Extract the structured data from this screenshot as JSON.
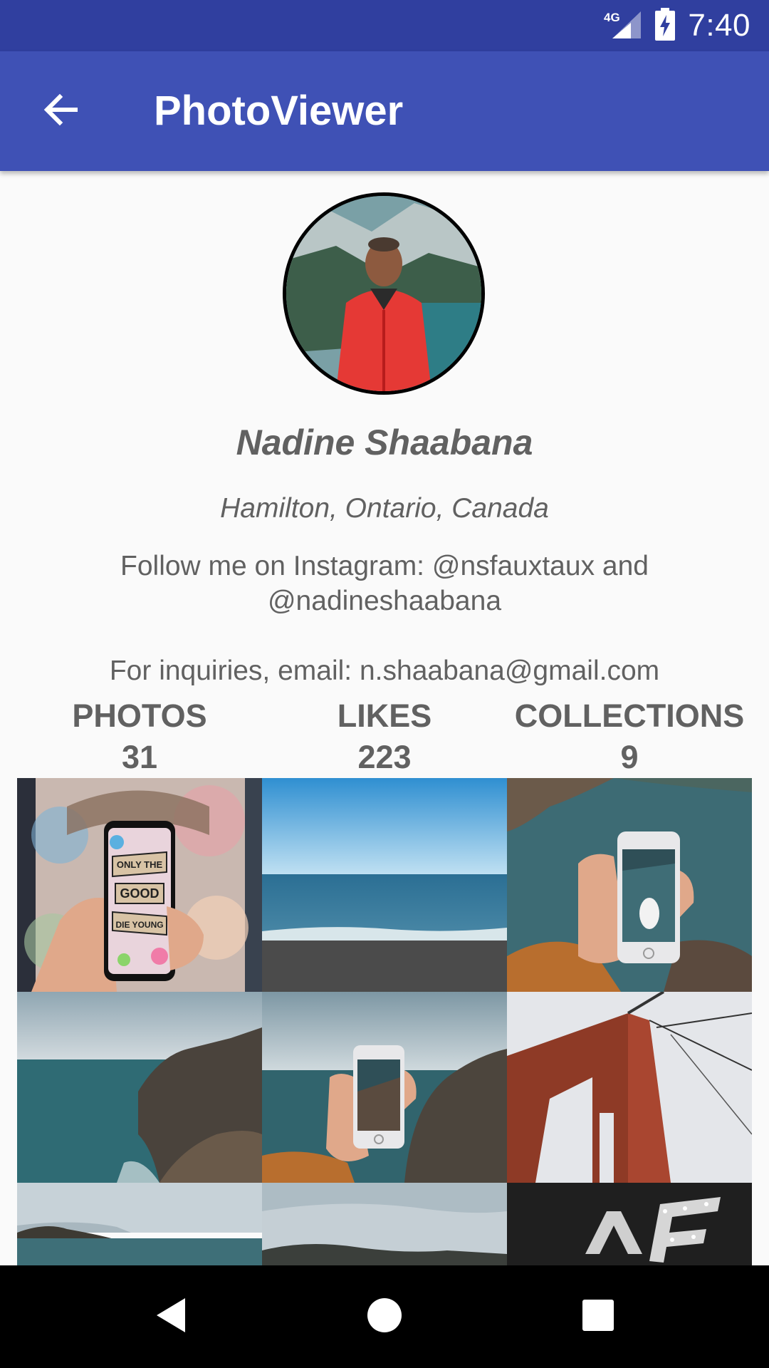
{
  "status_bar": {
    "network": "4G",
    "time": "7:40"
  },
  "app_bar": {
    "title": "PhotoViewer",
    "back_icon": "arrow-back-icon"
  },
  "profile": {
    "name": "Nadine Shaabana",
    "location": "Hamilton, Ontario, Canada",
    "bio": "Follow me on Instagram: @nsfauxtaux and\n@nadineshaabana\n\nFor inquiries, email: n.shaabana@gmail.com"
  },
  "stats": [
    {
      "label": "PHOTOS",
      "value": "31"
    },
    {
      "label": "LIKES",
      "value": "223"
    },
    {
      "label": "COLLECTIONS",
      "value": "9"
    }
  ],
  "photos": [
    {
      "subject": "hand holding phone with ONLY THE GOOD DIE YOUNG screen"
    },
    {
      "subject": "ocean horizon with beach"
    },
    {
      "subject": "hand holding phone over coastline"
    },
    {
      "subject": "coastal cliffs and sea"
    },
    {
      "subject": "hand holding phone over cliffs"
    },
    {
      "subject": "red bridge tower"
    },
    {
      "subject": "coastline under cloudy sky"
    },
    {
      "subject": "hills under cloudy sky"
    },
    {
      "subject": "lit marquee letters"
    }
  ],
  "photo_text": {
    "phone_screen_lines": [
      "ONLY THE",
      "GOOD",
      "DIE YOUNG"
    ]
  },
  "colors": {
    "status_bar": "#303f9f",
    "app_bar": "#3f51b5",
    "text_secondary": "#616161",
    "background": "#fafafa"
  },
  "nav_bar": {
    "back": "nav-back-icon",
    "home": "nav-home-icon",
    "recents": "nav-recents-icon"
  }
}
